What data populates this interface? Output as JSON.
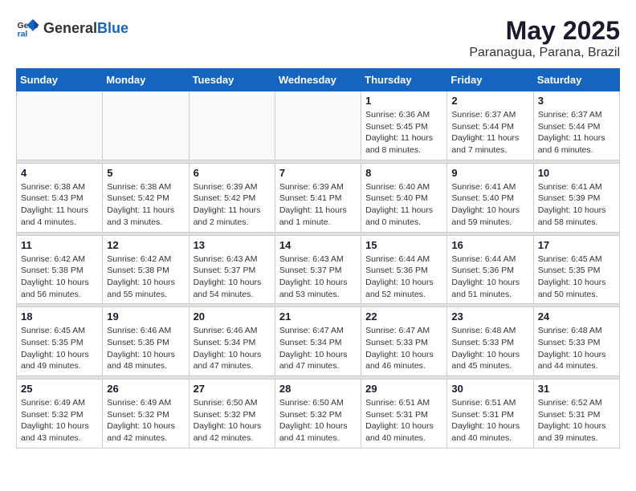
{
  "header": {
    "logo_general": "General",
    "logo_blue": "Blue",
    "month_title": "May 2025",
    "location": "Paranagua, Parana, Brazil"
  },
  "weekdays": [
    "Sunday",
    "Monday",
    "Tuesday",
    "Wednesday",
    "Thursday",
    "Friday",
    "Saturday"
  ],
  "weeks": [
    [
      {
        "day": "",
        "info": ""
      },
      {
        "day": "",
        "info": ""
      },
      {
        "day": "",
        "info": ""
      },
      {
        "day": "",
        "info": ""
      },
      {
        "day": "1",
        "info": "Sunrise: 6:36 AM\nSunset: 5:45 PM\nDaylight: 11 hours\nand 8 minutes."
      },
      {
        "day": "2",
        "info": "Sunrise: 6:37 AM\nSunset: 5:44 PM\nDaylight: 11 hours\nand 7 minutes."
      },
      {
        "day": "3",
        "info": "Sunrise: 6:37 AM\nSunset: 5:44 PM\nDaylight: 11 hours\nand 6 minutes."
      }
    ],
    [
      {
        "day": "4",
        "info": "Sunrise: 6:38 AM\nSunset: 5:43 PM\nDaylight: 11 hours\nand 4 minutes."
      },
      {
        "day": "5",
        "info": "Sunrise: 6:38 AM\nSunset: 5:42 PM\nDaylight: 11 hours\nand 3 minutes."
      },
      {
        "day": "6",
        "info": "Sunrise: 6:39 AM\nSunset: 5:42 PM\nDaylight: 11 hours\nand 2 minutes."
      },
      {
        "day": "7",
        "info": "Sunrise: 6:39 AM\nSunset: 5:41 PM\nDaylight: 11 hours\nand 1 minute."
      },
      {
        "day": "8",
        "info": "Sunrise: 6:40 AM\nSunset: 5:40 PM\nDaylight: 11 hours\nand 0 minutes."
      },
      {
        "day": "9",
        "info": "Sunrise: 6:41 AM\nSunset: 5:40 PM\nDaylight: 10 hours\nand 59 minutes."
      },
      {
        "day": "10",
        "info": "Sunrise: 6:41 AM\nSunset: 5:39 PM\nDaylight: 10 hours\nand 58 minutes."
      }
    ],
    [
      {
        "day": "11",
        "info": "Sunrise: 6:42 AM\nSunset: 5:38 PM\nDaylight: 10 hours\nand 56 minutes."
      },
      {
        "day": "12",
        "info": "Sunrise: 6:42 AM\nSunset: 5:38 PM\nDaylight: 10 hours\nand 55 minutes."
      },
      {
        "day": "13",
        "info": "Sunrise: 6:43 AM\nSunset: 5:37 PM\nDaylight: 10 hours\nand 54 minutes."
      },
      {
        "day": "14",
        "info": "Sunrise: 6:43 AM\nSunset: 5:37 PM\nDaylight: 10 hours\nand 53 minutes."
      },
      {
        "day": "15",
        "info": "Sunrise: 6:44 AM\nSunset: 5:36 PM\nDaylight: 10 hours\nand 52 minutes."
      },
      {
        "day": "16",
        "info": "Sunrise: 6:44 AM\nSunset: 5:36 PM\nDaylight: 10 hours\nand 51 minutes."
      },
      {
        "day": "17",
        "info": "Sunrise: 6:45 AM\nSunset: 5:35 PM\nDaylight: 10 hours\nand 50 minutes."
      }
    ],
    [
      {
        "day": "18",
        "info": "Sunrise: 6:45 AM\nSunset: 5:35 PM\nDaylight: 10 hours\nand 49 minutes."
      },
      {
        "day": "19",
        "info": "Sunrise: 6:46 AM\nSunset: 5:35 PM\nDaylight: 10 hours\nand 48 minutes."
      },
      {
        "day": "20",
        "info": "Sunrise: 6:46 AM\nSunset: 5:34 PM\nDaylight: 10 hours\nand 47 minutes."
      },
      {
        "day": "21",
        "info": "Sunrise: 6:47 AM\nSunset: 5:34 PM\nDaylight: 10 hours\nand 47 minutes."
      },
      {
        "day": "22",
        "info": "Sunrise: 6:47 AM\nSunset: 5:33 PM\nDaylight: 10 hours\nand 46 minutes."
      },
      {
        "day": "23",
        "info": "Sunrise: 6:48 AM\nSunset: 5:33 PM\nDaylight: 10 hours\nand 45 minutes."
      },
      {
        "day": "24",
        "info": "Sunrise: 6:48 AM\nSunset: 5:33 PM\nDaylight: 10 hours\nand 44 minutes."
      }
    ],
    [
      {
        "day": "25",
        "info": "Sunrise: 6:49 AM\nSunset: 5:32 PM\nDaylight: 10 hours\nand 43 minutes."
      },
      {
        "day": "26",
        "info": "Sunrise: 6:49 AM\nSunset: 5:32 PM\nDaylight: 10 hours\nand 42 minutes."
      },
      {
        "day": "27",
        "info": "Sunrise: 6:50 AM\nSunset: 5:32 PM\nDaylight: 10 hours\nand 42 minutes."
      },
      {
        "day": "28",
        "info": "Sunrise: 6:50 AM\nSunset: 5:32 PM\nDaylight: 10 hours\nand 41 minutes."
      },
      {
        "day": "29",
        "info": "Sunrise: 6:51 AM\nSunset: 5:31 PM\nDaylight: 10 hours\nand 40 minutes."
      },
      {
        "day": "30",
        "info": "Sunrise: 6:51 AM\nSunset: 5:31 PM\nDaylight: 10 hours\nand 40 minutes."
      },
      {
        "day": "31",
        "info": "Sunrise: 6:52 AM\nSunset: 5:31 PM\nDaylight: 10 hours\nand 39 minutes."
      }
    ]
  ]
}
